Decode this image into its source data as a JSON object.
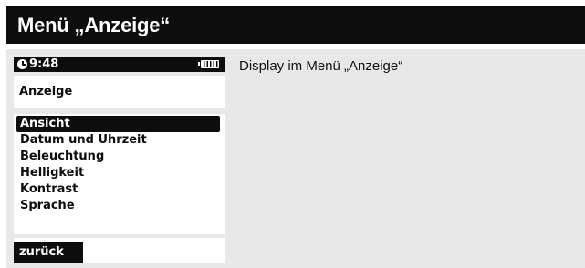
{
  "header": {
    "title": "Menü „Anzeige“"
  },
  "caption": "Display im Menü „Anzeige“",
  "device": {
    "status": {
      "time": "9:48",
      "clock_icon": "clock-icon",
      "battery_icon": "battery-full-icon"
    },
    "screen_title": "Anzeige",
    "menu": {
      "items": [
        {
          "label": "Ansicht",
          "selected": true
        },
        {
          "label": "Datum und Uhrzeit",
          "selected": false
        },
        {
          "label": "Beleuchtung",
          "selected": false
        },
        {
          "label": "Helligkeit",
          "selected": false
        },
        {
          "label": "Kontrast",
          "selected": false
        },
        {
          "label": "Sprache",
          "selected": false
        }
      ]
    },
    "footer": {
      "back_label": "zurück"
    }
  },
  "colors": {
    "header_bg": "#0d0d0d",
    "content_bg": "#e8e8e8",
    "selection_bg": "#0d0d0d",
    "display_bg": "#ffffff"
  }
}
